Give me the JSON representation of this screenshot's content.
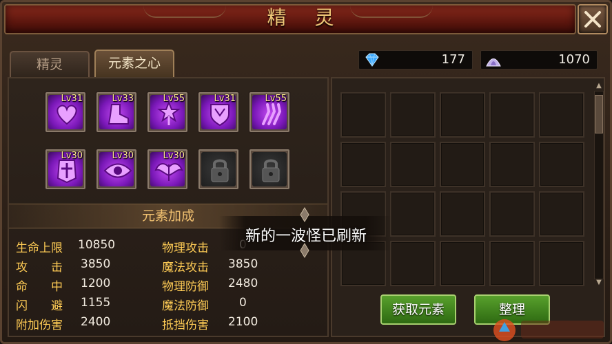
{
  "window": {
    "title": "精 灵",
    "close_icon": "close-x-icon"
  },
  "tabs": [
    {
      "label": "精灵",
      "active": false
    },
    {
      "label": "元素之心",
      "active": true
    }
  ],
  "currency": [
    {
      "icon": "blue-diamond-icon",
      "value": "177"
    },
    {
      "icon": "purple-crystal-icon",
      "value": "1070"
    }
  ],
  "element_slots": [
    {
      "level": "Lv31",
      "icon": "heart-emblem-icon",
      "locked": false
    },
    {
      "level": "Lv33",
      "icon": "boot-emblem-icon",
      "locked": false
    },
    {
      "level": "Lv55",
      "icon": "star-staff-emblem-icon",
      "locked": false
    },
    {
      "level": "Lv31",
      "icon": "shield-emblem-icon",
      "locked": false
    },
    {
      "level": "Lv55",
      "icon": "claw-emblem-icon",
      "locked": false
    },
    {
      "level": "Lv30",
      "icon": "armor-emblem-icon",
      "locked": false
    },
    {
      "level": "Lv30",
      "icon": "eye-emblem-icon",
      "locked": false
    },
    {
      "level": "Lv30",
      "icon": "wings-emblem-icon",
      "locked": false
    },
    {
      "level": "",
      "icon": "padlock-icon",
      "locked": true
    },
    {
      "level": "",
      "icon": "padlock-icon",
      "locked": true
    }
  ],
  "bonus": {
    "header": "元素加成",
    "stats_left": [
      {
        "label": "生命上限",
        "value": "10850"
      },
      {
        "label": "攻　　击",
        "value": "3850"
      },
      {
        "label": "命　　中",
        "value": "1200"
      },
      {
        "label": "闪　　避",
        "value": "1155"
      },
      {
        "label": "附加伤害",
        "value": "2400"
      }
    ],
    "stats_right": [
      {
        "label": "物理攻击",
        "value": "0"
      },
      {
        "label": "魔法攻击",
        "value": "3850"
      },
      {
        "label": "物理防御",
        "value": "2480"
      },
      {
        "label": "魔法防御",
        "value": "0"
      },
      {
        "label": "抵挡伤害",
        "value": "2100"
      }
    ]
  },
  "inventory": {
    "rows": 4,
    "cols": 5
  },
  "buttons": {
    "obtain": "获取元素",
    "sort": "整理"
  },
  "toast": {
    "message": "新的一波怪已刷新"
  },
  "colors": {
    "title_text": "#f0c878",
    "stat_label": "#ffcc55",
    "level_text": "#ffe890",
    "slot_purple": "#a030e0",
    "button_green": "#4a8c22"
  }
}
